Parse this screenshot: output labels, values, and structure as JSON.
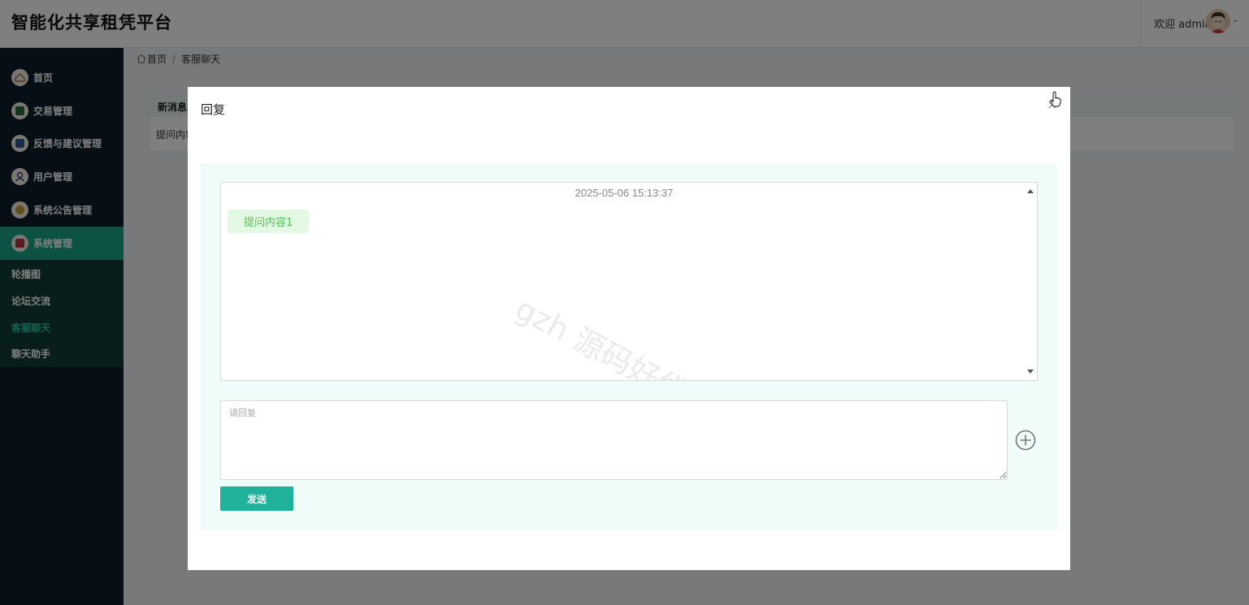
{
  "header": {
    "title": "智能化共享租凭平台",
    "welcome": "欢迎 admin"
  },
  "sidebar": {
    "items": [
      {
        "label": "首页",
        "icon": "home-icon"
      },
      {
        "label": "交易管理",
        "icon": "trade-icon"
      },
      {
        "label": "反馈与建议管理",
        "icon": "feedback-icon"
      },
      {
        "label": "用户管理",
        "icon": "user-icon"
      },
      {
        "label": "系统公告管理",
        "icon": "notice-icon"
      },
      {
        "label": "系统管理",
        "icon": "system-icon"
      }
    ],
    "sub_items": [
      "轮播图",
      "论坛交流",
      "客服聊天",
      "聊天助手"
    ],
    "active_sub": "客服聊天"
  },
  "breadcrumb": {
    "home": "首页",
    "sep": "/",
    "current": "客服聊天"
  },
  "table": {
    "header": "新消息",
    "row_text": "提问内容"
  },
  "dialog": {
    "title": "回复",
    "close": "×",
    "messages": [
      {
        "time": "2025-05-06 15:13:37",
        "text": "提问内容1"
      }
    ],
    "watermark": "gzh 源码好优多",
    "reply_placeholder": "请回复",
    "send_label": "发送"
  },
  "colors": {
    "accent": "#1fb19a",
    "sidebar_bg": "#0d1f2b",
    "sidebar_active": "#1aa68a",
    "bubble_bg": "#e4f9e3",
    "bubble_text": "#55c05a"
  }
}
